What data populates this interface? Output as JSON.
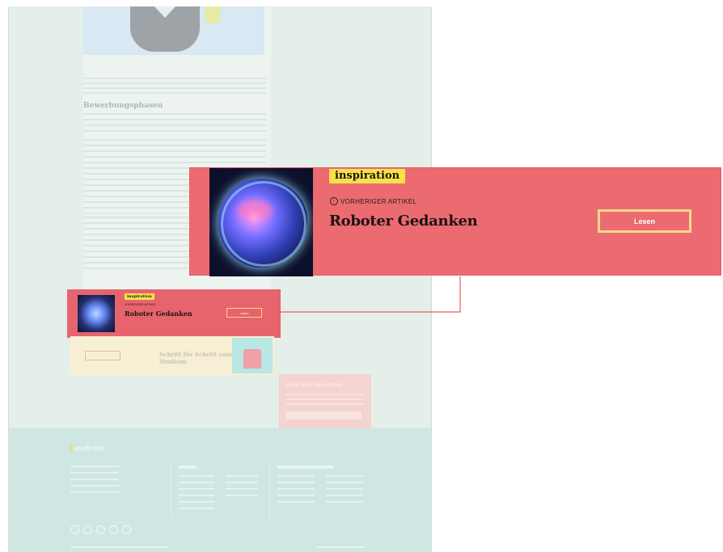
{
  "colors": {
    "teaser_bg": "#eb6b70",
    "tag_bg": "#f7e24a",
    "button_border": "#f6d98d",
    "connector_line": "#e85c64",
    "page_bg": "#e4efe9",
    "footer_bg": "#cfe7e2"
  },
  "teaser": {
    "tag": "inspiration",
    "prev_label": "VORHERIGER ARTIKEL",
    "prev_icon": "chevron-left-circle-icon",
    "title": "Roboter Gedanken",
    "button_label": "Lesen"
  },
  "small_teaser": {
    "tag": "inspiration",
    "prev_label": "VORHERIGER ARTIKEL",
    "title": "Roboter Gedanken",
    "button_label": "Lesen"
  },
  "article": {
    "section_title": "Bewerbungsphasen"
  },
  "card_steps": {
    "title": "Schritt für Schritt zum Studium"
  },
  "newsletter": {
    "title": "studi.info Newsletter"
  },
  "footer": {
    "logo": "studi.info"
  }
}
